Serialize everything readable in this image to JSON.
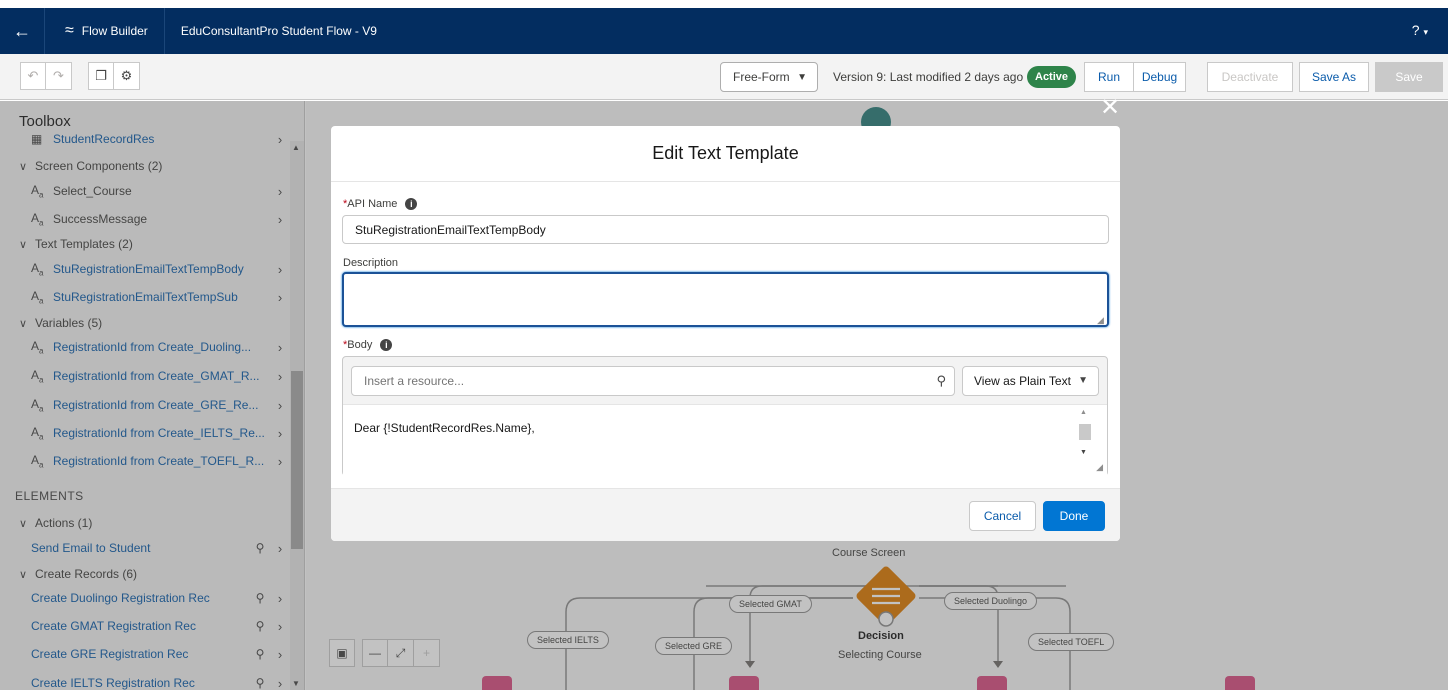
{
  "header": {
    "back_icon": "arrow-left-icon",
    "app_name": "Flow Builder",
    "flow_name": "EduConsultantPro Student Flow - V9",
    "help": "?"
  },
  "toolbar": {
    "layout_mode": "Free-Form",
    "version_text": "Version 9: Last modified 2 days ago",
    "status_badge": "Active",
    "run": "Run",
    "debug": "Debug",
    "deactivate": "Deactivate",
    "save_as": "Save As",
    "save": "Save"
  },
  "toolbox": {
    "title": "Toolbox",
    "partial_item": "StudentRecordRes",
    "sections": {
      "screen_components": "Screen Components (2)",
      "text_templates": "Text Templates (2)",
      "variables": "Variables (5)",
      "elements_label": "ELEMENTS",
      "actions": "Actions (1)",
      "create_records": "Create Records (6)"
    },
    "screen_components": [
      "Select_Course",
      "SuccessMessage"
    ],
    "text_templates": [
      "StuRegistrationEmailTextTempBody",
      "StuRegistrationEmailTextTempSub"
    ],
    "variables": [
      "RegistrationId from Create_Duoling...",
      "RegistrationId from Create_GMAT_R...",
      "RegistrationId from Create_GRE_Re...",
      "RegistrationId from Create_IELTS_Re...",
      "RegistrationId from Create_TOEFL_R..."
    ],
    "actions": [
      "Send Email to Student"
    ],
    "create_records": [
      "Create Duolingo Registration Rec",
      "Create GMAT Registration Rec",
      "Create GRE Registration Rec",
      "Create IELTS Registration Rec"
    ],
    "resource_type_glyph": "A"
  },
  "modal": {
    "title": "Edit Text Template",
    "api_name_label": "API Name",
    "api_name_value": "StuRegistrationEmailTextTempBody",
    "description_label": "Description",
    "description_value": "",
    "body_label": "Body",
    "resource_placeholder": "Insert a resource...",
    "view_mode": "View as Plain Text",
    "body_text": "Dear {!StudentRecordRes.Name},",
    "cancel": "Cancel",
    "done": "Done",
    "required_mark": "*"
  },
  "canvas": {
    "course_screen_label": "Course Screen",
    "decision_title": "Decision",
    "decision_subtitle": "Selecting Course",
    "branches": [
      "Selected GMAT",
      "Selected Duolingo",
      "Selected IELTS",
      "Selected GRE",
      "Selected TOEFL"
    ]
  },
  "colors": {
    "header_bg": "#032d60",
    "brand_blue": "#0176d3",
    "active_green": "#2e844a",
    "decision_orange": "#dd7a01",
    "node_pink": "#d94e81"
  }
}
